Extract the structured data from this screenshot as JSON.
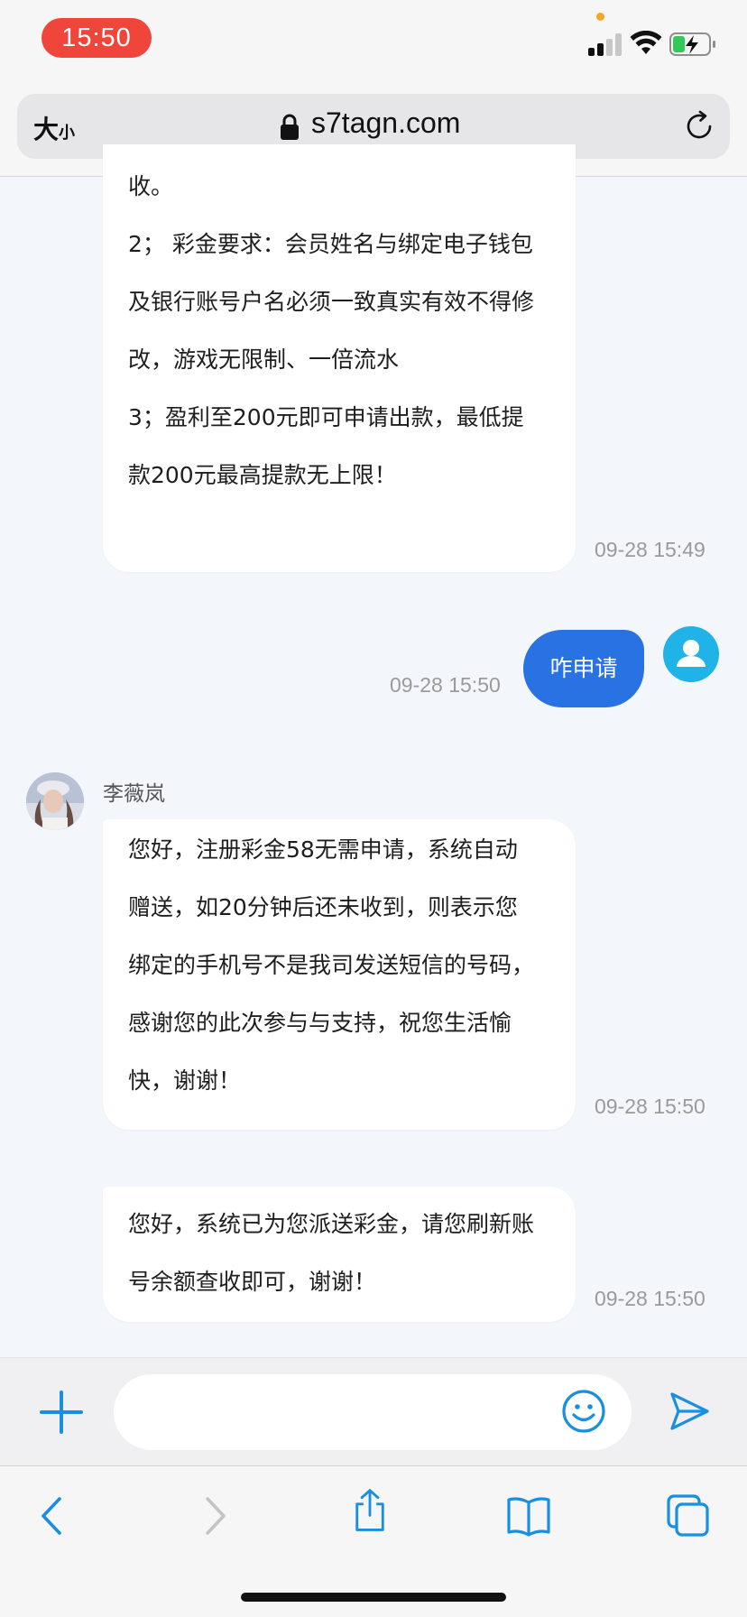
{
  "status_bar": {
    "time": "15:50"
  },
  "browser": {
    "text_size_label_big": "大",
    "text_size_label_small": "小",
    "url": "s7tagn.com"
  },
  "chat": {
    "messages": [
      {
        "lines": [
          "收。",
          "2； 彩金要求：会员姓名与绑定电子钱包",
          "及银行账号户名必须一致真实有效不得修",
          "改，游戏无限制、一倍流水",
          "3；盈利至200元即可申请出款，最低提",
          "款200元最高提款无上限！"
        ],
        "time": "09-28 15:49"
      },
      {
        "text": "咋申请",
        "time": "09-28 15:50"
      },
      {
        "sender": "李薇岚"
      },
      {
        "lines": [
          "您好，注册彩金58无需申请，系统自动",
          "赠送，如20分钟后还未收到，则表示您",
          "绑定的手机号不是我司发送短信的号码，",
          "感谢您的此次参与与支持，祝您生活愉",
          "快，谢谢！"
        ],
        "time": "09-28 15:50"
      },
      {
        "lines": [
          "您好，系统已为您派送彩金，请您刷新账",
          "号余额查收即可，谢谢！"
        ],
        "time": "09-28 15:50"
      }
    ]
  },
  "input": {
    "placeholder": "",
    "value": ""
  },
  "colors": {
    "accent": "#2872e3",
    "icon_blue": "#1a8fe0",
    "avatar_teal": "#1fb3e8"
  }
}
